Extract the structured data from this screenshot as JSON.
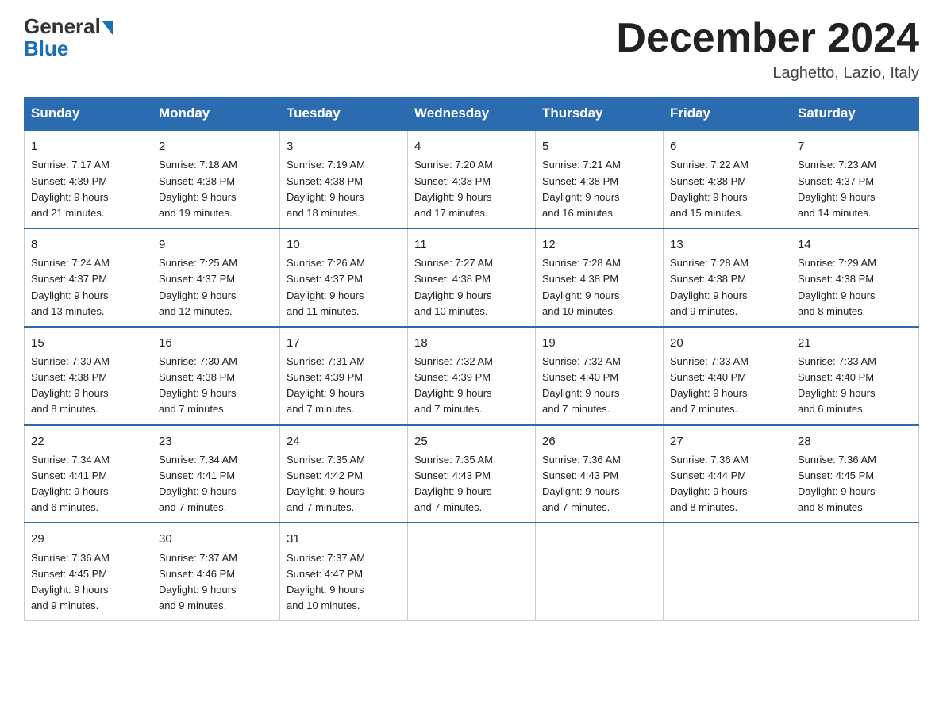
{
  "header": {
    "logo_top": "General",
    "logo_arrow": "▲",
    "logo_bottom": "Blue",
    "month_title": "December 2024",
    "location": "Laghetto, Lazio, Italy"
  },
  "weekdays": [
    "Sunday",
    "Monday",
    "Tuesday",
    "Wednesday",
    "Thursday",
    "Friday",
    "Saturday"
  ],
  "weeks": [
    [
      {
        "day": "1",
        "info": "Sunrise: 7:17 AM\nSunset: 4:39 PM\nDaylight: 9 hours\nand 21 minutes."
      },
      {
        "day": "2",
        "info": "Sunrise: 7:18 AM\nSunset: 4:38 PM\nDaylight: 9 hours\nand 19 minutes."
      },
      {
        "day": "3",
        "info": "Sunrise: 7:19 AM\nSunset: 4:38 PM\nDaylight: 9 hours\nand 18 minutes."
      },
      {
        "day": "4",
        "info": "Sunrise: 7:20 AM\nSunset: 4:38 PM\nDaylight: 9 hours\nand 17 minutes."
      },
      {
        "day": "5",
        "info": "Sunrise: 7:21 AM\nSunset: 4:38 PM\nDaylight: 9 hours\nand 16 minutes."
      },
      {
        "day": "6",
        "info": "Sunrise: 7:22 AM\nSunset: 4:38 PM\nDaylight: 9 hours\nand 15 minutes."
      },
      {
        "day": "7",
        "info": "Sunrise: 7:23 AM\nSunset: 4:37 PM\nDaylight: 9 hours\nand 14 minutes."
      }
    ],
    [
      {
        "day": "8",
        "info": "Sunrise: 7:24 AM\nSunset: 4:37 PM\nDaylight: 9 hours\nand 13 minutes."
      },
      {
        "day": "9",
        "info": "Sunrise: 7:25 AM\nSunset: 4:37 PM\nDaylight: 9 hours\nand 12 minutes."
      },
      {
        "day": "10",
        "info": "Sunrise: 7:26 AM\nSunset: 4:37 PM\nDaylight: 9 hours\nand 11 minutes."
      },
      {
        "day": "11",
        "info": "Sunrise: 7:27 AM\nSunset: 4:38 PM\nDaylight: 9 hours\nand 10 minutes."
      },
      {
        "day": "12",
        "info": "Sunrise: 7:28 AM\nSunset: 4:38 PM\nDaylight: 9 hours\nand 10 minutes."
      },
      {
        "day": "13",
        "info": "Sunrise: 7:28 AM\nSunset: 4:38 PM\nDaylight: 9 hours\nand 9 minutes."
      },
      {
        "day": "14",
        "info": "Sunrise: 7:29 AM\nSunset: 4:38 PM\nDaylight: 9 hours\nand 8 minutes."
      }
    ],
    [
      {
        "day": "15",
        "info": "Sunrise: 7:30 AM\nSunset: 4:38 PM\nDaylight: 9 hours\nand 8 minutes."
      },
      {
        "day": "16",
        "info": "Sunrise: 7:30 AM\nSunset: 4:38 PM\nDaylight: 9 hours\nand 7 minutes."
      },
      {
        "day": "17",
        "info": "Sunrise: 7:31 AM\nSunset: 4:39 PM\nDaylight: 9 hours\nand 7 minutes."
      },
      {
        "day": "18",
        "info": "Sunrise: 7:32 AM\nSunset: 4:39 PM\nDaylight: 9 hours\nand 7 minutes."
      },
      {
        "day": "19",
        "info": "Sunrise: 7:32 AM\nSunset: 4:40 PM\nDaylight: 9 hours\nand 7 minutes."
      },
      {
        "day": "20",
        "info": "Sunrise: 7:33 AM\nSunset: 4:40 PM\nDaylight: 9 hours\nand 7 minutes."
      },
      {
        "day": "21",
        "info": "Sunrise: 7:33 AM\nSunset: 4:40 PM\nDaylight: 9 hours\nand 6 minutes."
      }
    ],
    [
      {
        "day": "22",
        "info": "Sunrise: 7:34 AM\nSunset: 4:41 PM\nDaylight: 9 hours\nand 6 minutes."
      },
      {
        "day": "23",
        "info": "Sunrise: 7:34 AM\nSunset: 4:41 PM\nDaylight: 9 hours\nand 7 minutes."
      },
      {
        "day": "24",
        "info": "Sunrise: 7:35 AM\nSunset: 4:42 PM\nDaylight: 9 hours\nand 7 minutes."
      },
      {
        "day": "25",
        "info": "Sunrise: 7:35 AM\nSunset: 4:43 PM\nDaylight: 9 hours\nand 7 minutes."
      },
      {
        "day": "26",
        "info": "Sunrise: 7:36 AM\nSunset: 4:43 PM\nDaylight: 9 hours\nand 7 minutes."
      },
      {
        "day": "27",
        "info": "Sunrise: 7:36 AM\nSunset: 4:44 PM\nDaylight: 9 hours\nand 8 minutes."
      },
      {
        "day": "28",
        "info": "Sunrise: 7:36 AM\nSunset: 4:45 PM\nDaylight: 9 hours\nand 8 minutes."
      }
    ],
    [
      {
        "day": "29",
        "info": "Sunrise: 7:36 AM\nSunset: 4:45 PM\nDaylight: 9 hours\nand 9 minutes."
      },
      {
        "day": "30",
        "info": "Sunrise: 7:37 AM\nSunset: 4:46 PM\nDaylight: 9 hours\nand 9 minutes."
      },
      {
        "day": "31",
        "info": "Sunrise: 7:37 AM\nSunset: 4:47 PM\nDaylight: 9 hours\nand 10 minutes."
      },
      {
        "day": "",
        "info": ""
      },
      {
        "day": "",
        "info": ""
      },
      {
        "day": "",
        "info": ""
      },
      {
        "day": "",
        "info": ""
      }
    ]
  ]
}
